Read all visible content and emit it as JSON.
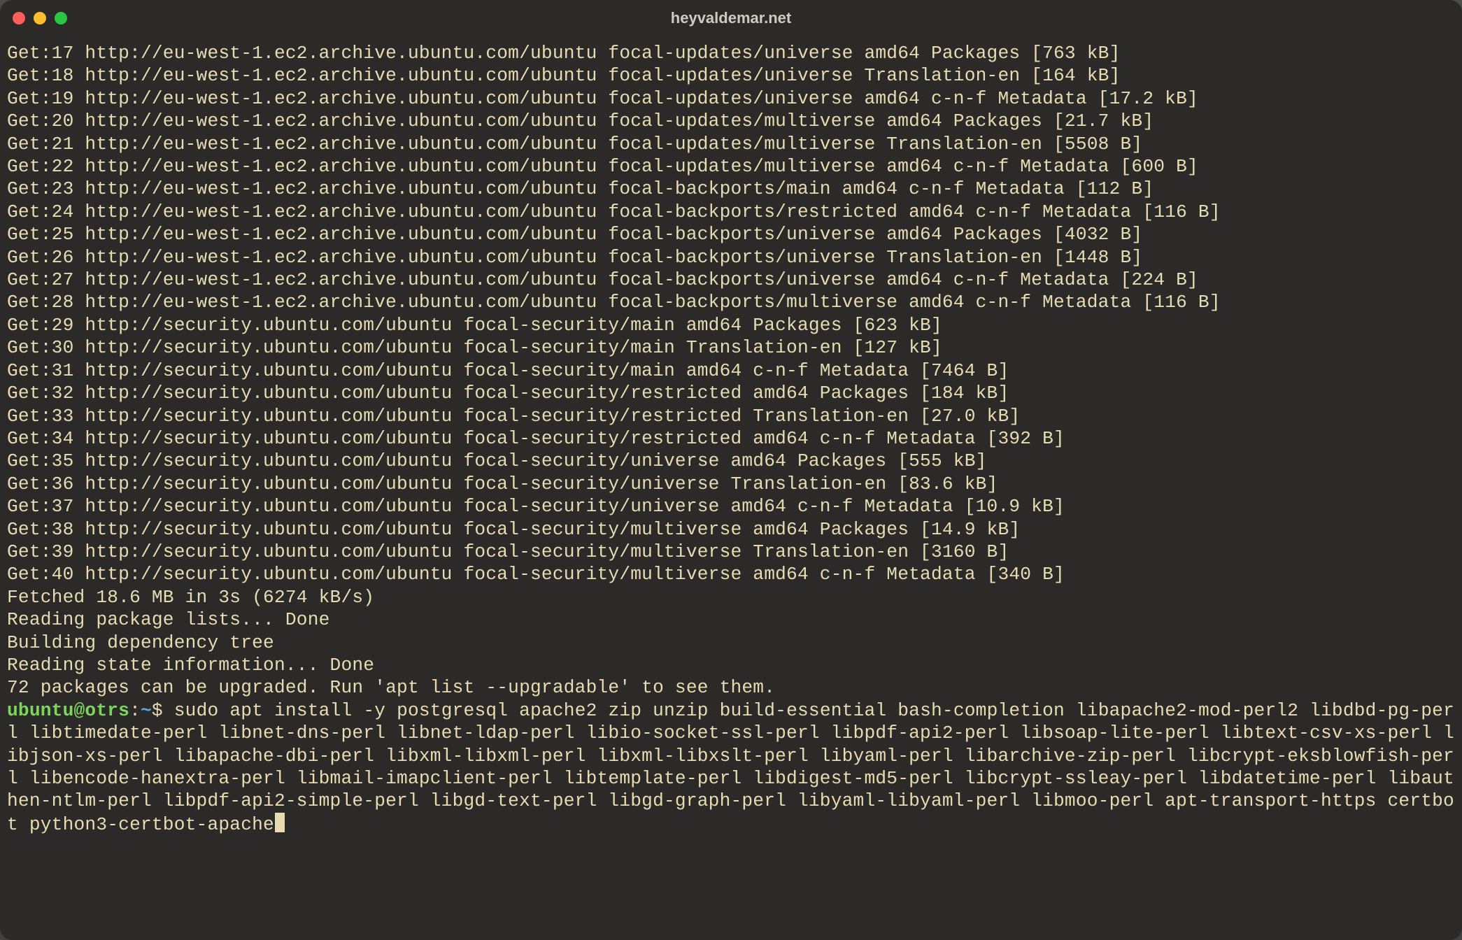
{
  "window": {
    "title": "heyvaldemar.net"
  },
  "terminal": {
    "lines": [
      "Get:17 http://eu-west-1.ec2.archive.ubuntu.com/ubuntu focal-updates/universe amd64 Packages [763 kB]",
      "Get:18 http://eu-west-1.ec2.archive.ubuntu.com/ubuntu focal-updates/universe Translation-en [164 kB]",
      "Get:19 http://eu-west-1.ec2.archive.ubuntu.com/ubuntu focal-updates/universe amd64 c-n-f Metadata [17.2 kB]",
      "Get:20 http://eu-west-1.ec2.archive.ubuntu.com/ubuntu focal-updates/multiverse amd64 Packages [21.7 kB]",
      "Get:21 http://eu-west-1.ec2.archive.ubuntu.com/ubuntu focal-updates/multiverse Translation-en [5508 B]",
      "Get:22 http://eu-west-1.ec2.archive.ubuntu.com/ubuntu focal-updates/multiverse amd64 c-n-f Metadata [600 B]",
      "Get:23 http://eu-west-1.ec2.archive.ubuntu.com/ubuntu focal-backports/main amd64 c-n-f Metadata [112 B]",
      "Get:24 http://eu-west-1.ec2.archive.ubuntu.com/ubuntu focal-backports/restricted amd64 c-n-f Metadata [116 B]",
      "Get:25 http://eu-west-1.ec2.archive.ubuntu.com/ubuntu focal-backports/universe amd64 Packages [4032 B]",
      "Get:26 http://eu-west-1.ec2.archive.ubuntu.com/ubuntu focal-backports/universe Translation-en [1448 B]",
      "Get:27 http://eu-west-1.ec2.archive.ubuntu.com/ubuntu focal-backports/universe amd64 c-n-f Metadata [224 B]",
      "Get:28 http://eu-west-1.ec2.archive.ubuntu.com/ubuntu focal-backports/multiverse amd64 c-n-f Metadata [116 B]",
      "Get:29 http://security.ubuntu.com/ubuntu focal-security/main amd64 Packages [623 kB]",
      "Get:30 http://security.ubuntu.com/ubuntu focal-security/main Translation-en [127 kB]",
      "Get:31 http://security.ubuntu.com/ubuntu focal-security/main amd64 c-n-f Metadata [7464 B]",
      "Get:32 http://security.ubuntu.com/ubuntu focal-security/restricted amd64 Packages [184 kB]",
      "Get:33 http://security.ubuntu.com/ubuntu focal-security/restricted Translation-en [27.0 kB]",
      "Get:34 http://security.ubuntu.com/ubuntu focal-security/restricted amd64 c-n-f Metadata [392 B]",
      "Get:35 http://security.ubuntu.com/ubuntu focal-security/universe amd64 Packages [555 kB]",
      "Get:36 http://security.ubuntu.com/ubuntu focal-security/universe Translation-en [83.6 kB]",
      "Get:37 http://security.ubuntu.com/ubuntu focal-security/universe amd64 c-n-f Metadata [10.9 kB]",
      "Get:38 http://security.ubuntu.com/ubuntu focal-security/multiverse amd64 Packages [14.9 kB]",
      "Get:39 http://security.ubuntu.com/ubuntu focal-security/multiverse Translation-en [3160 B]",
      "Get:40 http://security.ubuntu.com/ubuntu focal-security/multiverse amd64 c-n-f Metadata [340 B]",
      "Fetched 18.6 MB in 3s (6274 kB/s)",
      "Reading package lists... Done",
      "Building dependency tree",
      "Reading state information... Done",
      "72 packages can be upgraded. Run 'apt list --upgradable' to see them."
    ],
    "prompt": {
      "user_host": "ubuntu@otrs",
      "colon": ":",
      "path": "~",
      "symbol": "$ ",
      "command": "sudo apt install -y postgresql apache2 zip unzip build-essential bash-completion libapache2-mod-perl2 libdbd-pg-perl libtimedate-perl libnet-dns-perl libnet-ldap-perl libio-socket-ssl-perl libpdf-api2-perl libsoap-lite-perl libtext-csv-xs-perl libjson-xs-perl libapache-dbi-perl libxml-libxml-perl libxml-libxslt-perl libyaml-perl libarchive-zip-perl libcrypt-eksblowfish-perl libencode-hanextra-perl libmail-imapclient-perl libtemplate-perl libdigest-md5-perl libcrypt-ssleay-perl libdatetime-perl libauthen-ntlm-perl libpdf-api2-simple-perl libgd-text-perl libgd-graph-perl libyaml-libyaml-perl libmoo-perl apt-transport-https certbot python3-certbot-apache"
    }
  }
}
